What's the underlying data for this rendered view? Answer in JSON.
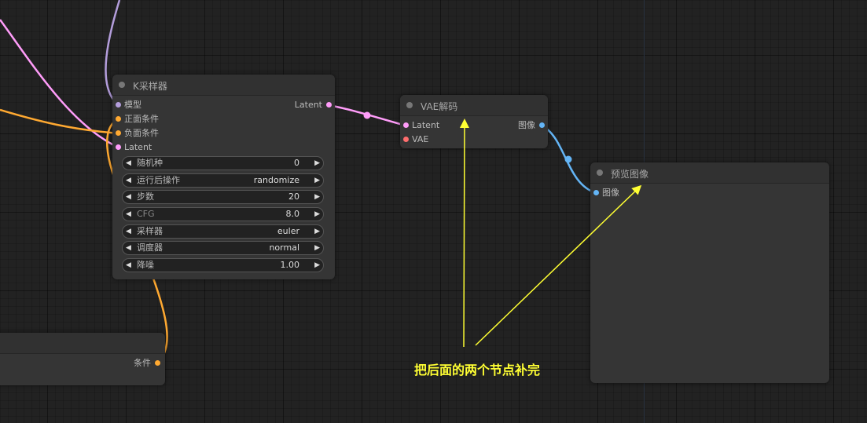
{
  "colors": {
    "model": "#b39ddb",
    "conditioning": "#ffa931",
    "latent": "#ff9cf9",
    "vae": "#ff6e6e",
    "image": "#64b5f6",
    "annotation": "#ffff33"
  },
  "ksampler": {
    "title": "K采样器",
    "inputs": [
      "模型",
      "正面条件",
      "负面条件",
      "Latent"
    ],
    "output": "Latent",
    "widgets": [
      {
        "label": "随机种",
        "value": "0"
      },
      {
        "label": "运行后操作",
        "value": "randomize"
      },
      {
        "label": "步数",
        "value": "20"
      },
      {
        "label": "CFG",
        "value": "8.0"
      },
      {
        "label": "采样器",
        "value": "euler"
      },
      {
        "label": "调度器",
        "value": "normal"
      },
      {
        "label": "降噪",
        "value": "1.00"
      }
    ]
  },
  "vae_decode": {
    "title": "VAE解码",
    "inputs": [
      "Latent",
      "VAE"
    ],
    "output": "图像"
  },
  "preview_image": {
    "title": "预览图像",
    "inputs": [
      "图像"
    ]
  },
  "partial_node": {
    "output": "条件"
  },
  "annotation": {
    "text": "把后面的两个节点补完"
  }
}
